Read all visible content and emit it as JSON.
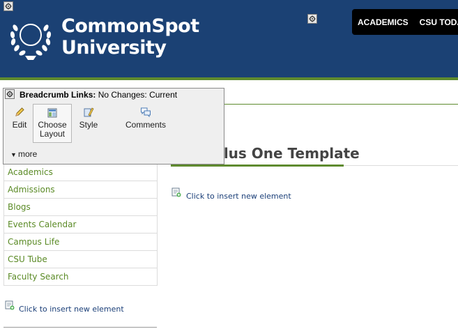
{
  "header": {
    "university_line1": "CommonSpot",
    "university_line2": "University",
    "nav": [
      {
        "label": "ACADEMICS"
      },
      {
        "label": "CSU TODAY"
      }
    ],
    "colors": {
      "brand_blue": "#1b4174",
      "accent_green": "#5e8a2e"
    }
  },
  "popup": {
    "title_bold": "Breadcrumb Links:",
    "title_rest": "No Changes: Current",
    "tools": [
      {
        "label": "Edit",
        "icon": "pencil-icon"
      },
      {
        "label": "Choose Layout",
        "icon": "layout-icon"
      },
      {
        "label": "Style",
        "icon": "style-brush-icon"
      },
      {
        "label": "Comments",
        "icon": "comments-icon"
      }
    ],
    "more_label": "more"
  },
  "sidebar": {
    "items": [
      {
        "label": "Academics"
      },
      {
        "label": "Admissions"
      },
      {
        "label": "Blogs"
      },
      {
        "label": "Events Calendar"
      },
      {
        "label": "Campus Life"
      },
      {
        "label": "CSU Tube"
      },
      {
        "label": "Faculty Search"
      }
    ],
    "insert_label": "Click to insert new element"
  },
  "main": {
    "title": "Base Plus One Template",
    "insert_label": "Click to insert new element"
  }
}
